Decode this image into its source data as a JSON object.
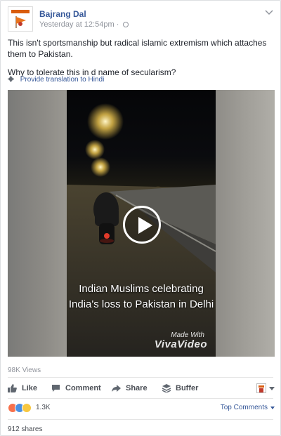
{
  "post": {
    "page_name": "Bajrang Dal",
    "timestamp": "Yesterday at 12:54pm",
    "audience_icon": "globe-icon",
    "text_lines": [
      "This isn't sportsmanship but radical islamic extremism which attaches them to Pakistan.",
      "Why to tolerate this in d name of secularism?"
    ],
    "translate_label": "Provide translation to Hindi"
  },
  "video": {
    "caption_line1": "Indian Muslims celebrating",
    "caption_line2": "India's loss to Pakistan in Delhi",
    "watermark_small": "Made With",
    "watermark_brand": "VivaVideo",
    "views": "98K Views"
  },
  "actions": {
    "like": "Like",
    "comment": "Comment",
    "share": "Share",
    "buffer": "Buffer"
  },
  "stats": {
    "reaction_icons": [
      "angry-icon",
      "like-icon",
      "haha-icon"
    ],
    "reaction_count": "1.3K",
    "top_comments": "Top Comments",
    "shares": "912 shares"
  },
  "colors": {
    "link": "#365899",
    "brand_orange": "#d95d0f"
  }
}
